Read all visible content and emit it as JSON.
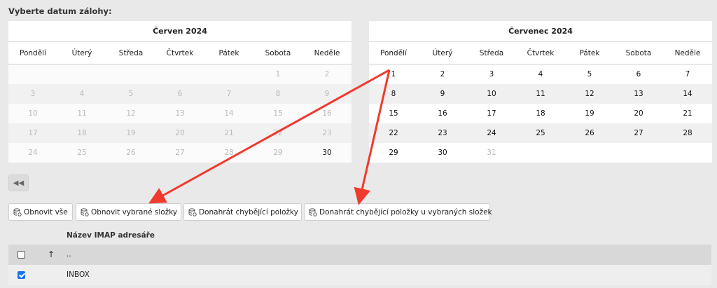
{
  "prompt": "Vyberte datum zálohy:",
  "weekdays": [
    "Pondělí",
    "Úterý",
    "Středa",
    "Čtvrtek",
    "Pátek",
    "Sobota",
    "Neděle"
  ],
  "calendars": [
    {
      "title": "Červen 2024",
      "weeks": [
        [
          {
            "d": ""
          },
          {
            "d": ""
          },
          {
            "d": ""
          },
          {
            "d": ""
          },
          {
            "d": ""
          },
          {
            "d": "1",
            "e": false
          },
          {
            "d": "2",
            "e": false
          }
        ],
        [
          {
            "d": "3",
            "e": false
          },
          {
            "d": "4",
            "e": false
          },
          {
            "d": "5",
            "e": false
          },
          {
            "d": "6",
            "e": false
          },
          {
            "d": "7",
            "e": false
          },
          {
            "d": "8",
            "e": false
          },
          {
            "d": "9",
            "e": false
          }
        ],
        [
          {
            "d": "10",
            "e": false
          },
          {
            "d": "11",
            "e": false
          },
          {
            "d": "12",
            "e": false
          },
          {
            "d": "13",
            "e": false
          },
          {
            "d": "14",
            "e": false
          },
          {
            "d": "15",
            "e": false
          },
          {
            "d": "16",
            "e": false
          }
        ],
        [
          {
            "d": "17",
            "e": false
          },
          {
            "d": "18",
            "e": false
          },
          {
            "d": "19",
            "e": false
          },
          {
            "d": "20",
            "e": false
          },
          {
            "d": "21",
            "e": false
          },
          {
            "d": "22",
            "e": false
          },
          {
            "d": "23",
            "e": false
          }
        ],
        [
          {
            "d": "24",
            "e": false
          },
          {
            "d": "25",
            "e": false
          },
          {
            "d": "26",
            "e": false
          },
          {
            "d": "27",
            "e": false
          },
          {
            "d": "28",
            "e": false
          },
          {
            "d": "29",
            "e": false
          },
          {
            "d": "30",
            "e": true
          }
        ]
      ]
    },
    {
      "title": "Červenec 2024",
      "weeks": [
        [
          {
            "d": "1",
            "e": true
          },
          {
            "d": "2",
            "e": true
          },
          {
            "d": "3",
            "e": true
          },
          {
            "d": "4",
            "e": true
          },
          {
            "d": "5",
            "e": true
          },
          {
            "d": "6",
            "e": true
          },
          {
            "d": "7",
            "e": true
          }
        ],
        [
          {
            "d": "8",
            "e": true
          },
          {
            "d": "9",
            "e": true
          },
          {
            "d": "10",
            "e": true
          },
          {
            "d": "11",
            "e": true
          },
          {
            "d": "12",
            "e": true
          },
          {
            "d": "13",
            "e": true
          },
          {
            "d": "14",
            "e": true
          }
        ],
        [
          {
            "d": "15",
            "e": true
          },
          {
            "d": "16",
            "e": true
          },
          {
            "d": "17",
            "e": true
          },
          {
            "d": "18",
            "e": true
          },
          {
            "d": "19",
            "e": true
          },
          {
            "d": "20",
            "e": true
          },
          {
            "d": "21",
            "e": true
          }
        ],
        [
          {
            "d": "22",
            "e": true
          },
          {
            "d": "23",
            "e": true
          },
          {
            "d": "24",
            "e": true
          },
          {
            "d": "25",
            "e": true
          },
          {
            "d": "26",
            "e": true
          },
          {
            "d": "27",
            "e": true
          },
          {
            "d": "28",
            "e": true
          }
        ],
        [
          {
            "d": "29",
            "e": true
          },
          {
            "d": "30",
            "e": true
          },
          {
            "d": "31",
            "e": false
          },
          {
            "d": ""
          },
          {
            "d": ""
          },
          {
            "d": ""
          },
          {
            "d": ""
          }
        ]
      ]
    }
  ],
  "nav": {
    "back_icon": "rewind-icon"
  },
  "buttons": {
    "restore_all": "Obnovit vše",
    "restore_selected": "Obnovit vybrané složky",
    "upload_missing": "Donahrát chybějící položky",
    "upload_missing_selected": "Donahrát chybějící položky u vybraných složek",
    "icon": "database-restore-icon"
  },
  "folders": {
    "column_header": "Název IMAP adresáře",
    "sort_icon": "arrow-up-icon",
    "rows": [
      {
        "name": "..",
        "checked": false
      },
      {
        "name": "INBOX",
        "checked": true
      }
    ]
  },
  "annotation_color": "#f03a2e"
}
